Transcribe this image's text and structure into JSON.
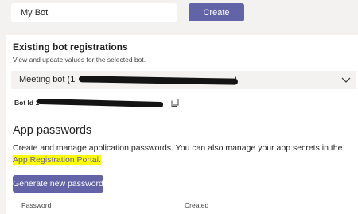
{
  "top": {
    "bot_name_value": "My Bot",
    "create_label": "Create"
  },
  "existing": {
    "title": "Existing bot registrations",
    "subtitle": "View and update values for the selected bot.",
    "selected_bot": "Meeting bot (1",
    "selected_bot_tail": ")",
    "bot_id_label": "Bot Id",
    "bot_id_prefix": "1"
  },
  "app_passwords": {
    "title": "App passwords",
    "description": "Create and manage application passwords. You can also manage your app secrets in the",
    "link_text": "App Registration Portal",
    "link_suffix": ".",
    "generate_label": "Generate new password",
    "columns": [
      "Password",
      "Created"
    ]
  },
  "colors": {
    "accent": "#6264a7",
    "highlight": "#ffff00",
    "background": "#f3f2f1"
  },
  "icons": {
    "dropdown": "chevron-down-icon",
    "copy": "copy-icon"
  }
}
